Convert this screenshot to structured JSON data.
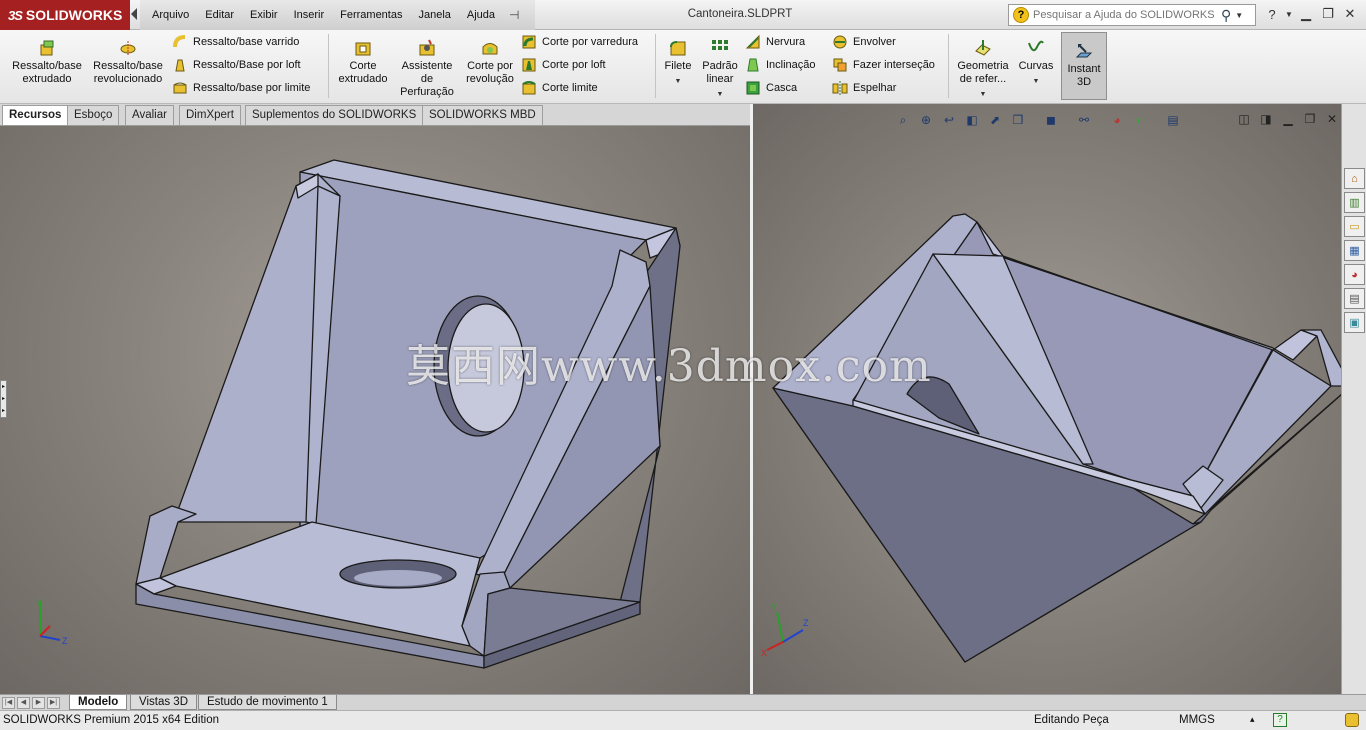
{
  "app": {
    "logo_text": "SOLIDWORKS",
    "logo_prefix": "3S",
    "document_title": "Cantoneira.SLDPRT"
  },
  "menu": [
    "Arquivo",
    "Editar",
    "Exibir",
    "Inserir",
    "Ferramentas",
    "Janela",
    "Ajuda"
  ],
  "search": {
    "placeholder": "Pesquisar a Ajuda do SOLIDWORKS"
  },
  "toolbar": {
    "extruded_boss": "Ressalto/base extrudado",
    "revolved_boss": "Ressalto/base revolucionado",
    "swept_boss": "Ressalto/base varrido",
    "lofted_boss": "Ressalto/Base por loft",
    "boundary_boss": "Ressalto/base por limite",
    "extruded_cut": "Corte extrudado",
    "hole_wizard": "Assistente de Perfuração",
    "revolved_cut": "Corte por revolução",
    "swept_cut": "Corte por varredura",
    "lofted_cut": "Corte por loft",
    "boundary_cut": "Corte limite",
    "fillet": "Filete",
    "linear_pattern": "Padrão linear",
    "rib": "Nervura",
    "draft": "Inclinação",
    "shell": "Casca",
    "wrap": "Envolver",
    "intersect": "Fazer interseção",
    "mirror": "Espelhar",
    "reference_geometry": "Geometria de refer...",
    "curves": "Curvas",
    "instant3d": "Instant 3D"
  },
  "tabs": [
    "Recursos",
    "Esboço",
    "Avaliar",
    "DimXpert",
    "Suplementos do SOLIDWORKS",
    "SOLIDWORKS MBD"
  ],
  "watermark": "莫西网www.3dmox.com",
  "triad": {
    "x": "X",
    "y": "Y",
    "z": "Z"
  },
  "bottom_tabs": [
    "Modelo",
    "Vistas 3D",
    "Estudo de movimento 1"
  ],
  "status": {
    "edition": "SOLIDWORKS Premium 2015 x64 Edition",
    "mode": "Editando Peça",
    "units": "MMGS",
    "units_arrow": "▴",
    "help": "?"
  },
  "colors": {
    "brand": "#a52020",
    "part_face_light": "#b8bbd4",
    "part_face_mid": "#9ea1bd",
    "part_face_dark": "#6e7088",
    "part_edge": "#1a1a1a"
  }
}
